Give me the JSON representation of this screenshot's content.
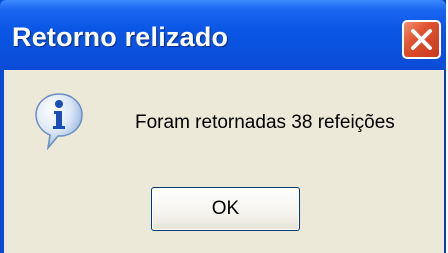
{
  "window": {
    "title": "Retorno relizado"
  },
  "dialog": {
    "icon": "info-icon",
    "message": "Foram retornadas 38 refeições",
    "ok_label": "OK"
  },
  "colors": {
    "titlebar": "#0a51df",
    "client_bg": "#ece9d8",
    "close_button": "#e0512f"
  }
}
